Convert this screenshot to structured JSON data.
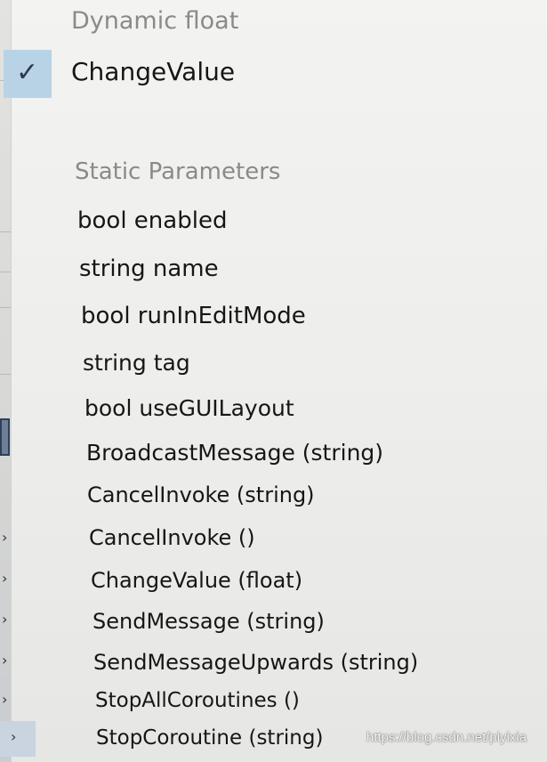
{
  "dynamic_section": {
    "header": "Dynamic float",
    "items": [
      {
        "label": "ChangeValue",
        "checked": true
      }
    ]
  },
  "static_section": {
    "header": "Static Parameters",
    "items": [
      {
        "label": "bool enabled"
      },
      {
        "label": "string name"
      },
      {
        "label": "bool runInEditMode"
      },
      {
        "label": "string tag"
      },
      {
        "label": "bool useGUILayout"
      },
      {
        "label": "BroadcastMessage (string)"
      },
      {
        "label": "CancelInvoke (string)"
      },
      {
        "label": "CancelInvoke ()"
      },
      {
        "label": "ChangeValue (float)"
      },
      {
        "label": "SendMessage (string)"
      },
      {
        "label": "SendMessageUpwards (string)"
      },
      {
        "label": "StopAllCoroutines ()"
      },
      {
        "label": "StopCoroutine (string)"
      }
    ]
  },
  "watermark": "https://blog.csdn.net/piyixia",
  "colors": {
    "menu_background": "#eeeeec",
    "header_text": "#8a8a8a",
    "item_text": "#161616",
    "check_highlight": "#b9d3e6"
  },
  "icons": {
    "check": "check-icon",
    "chevron": "chevron-right-icon"
  }
}
